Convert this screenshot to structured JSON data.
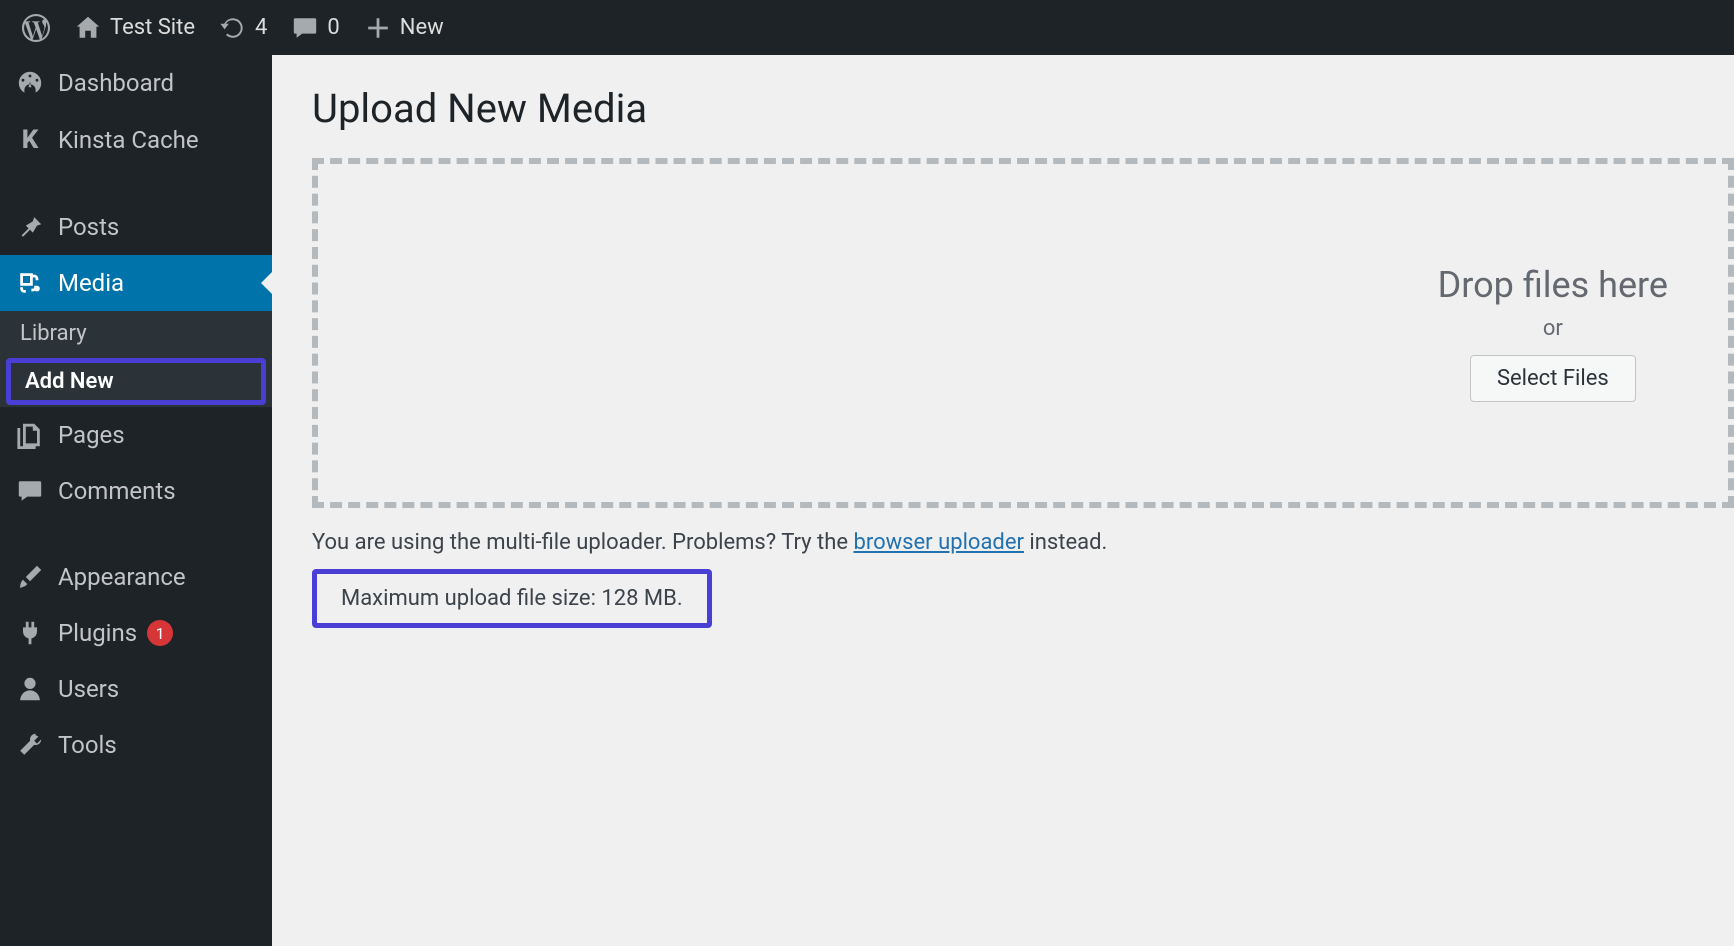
{
  "adminbar": {
    "site_name": "Test Site",
    "updates_count": "4",
    "comments_count": "0",
    "new_label": "New"
  },
  "sidebar": {
    "dashboard": "Dashboard",
    "kinsta": "Kinsta Cache",
    "posts": "Posts",
    "media": "Media",
    "media_sub_library": "Library",
    "media_sub_addnew": "Add New",
    "pages": "Pages",
    "comments": "Comments",
    "appearance": "Appearance",
    "plugins": "Plugins",
    "plugins_badge": "1",
    "users": "Users",
    "tools": "Tools"
  },
  "main": {
    "title": "Upload New Media",
    "drop_text": "Drop files here",
    "or_text": "or",
    "select_button": "Select Files",
    "hint_prefix": "You are using the multi-file uploader. Problems? Try the ",
    "hint_link": "browser uploader",
    "hint_suffix": " instead.",
    "max_size": "Maximum upload file size: 128 MB."
  }
}
